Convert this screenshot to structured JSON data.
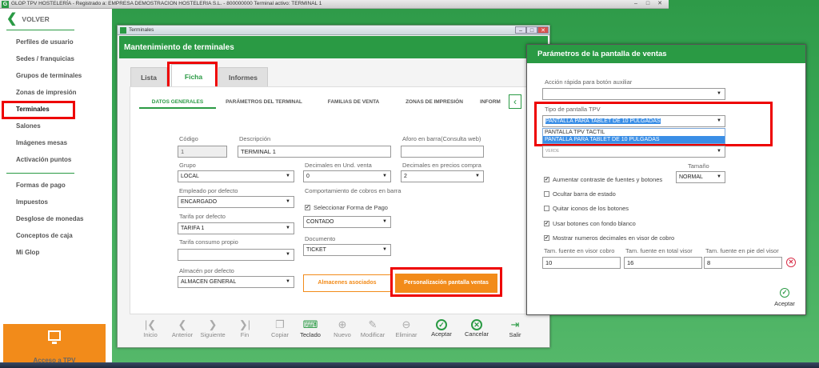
{
  "app_title": "GLOP TPV HOSTELERÍA - Registrado a: EMPRESA DEMOSTRACION HOSTELERIA S.L. - 800000000 Terminal activo: TERMINAL 1",
  "sidebar": {
    "back_label": "VOLVER",
    "items_top": [
      "Perfiles de usuario",
      "Sedes / franquicias",
      "Grupos de terminales",
      "Zonas de impresión",
      "Terminales",
      "Salones",
      "Imágenes mesas",
      "Activación puntos"
    ],
    "items_bottom": [
      "Formas de pago",
      "Impuestos",
      "Desglose de monedas",
      "Conceptos de caja",
      "Mi Glop"
    ],
    "active_item": "Terminales",
    "access_label": "Acceso a TPV"
  },
  "terminal_window": {
    "title": "Terminales",
    "header": "Mantenimiento de terminales",
    "tabs": [
      "Lista",
      "Ficha",
      "Informes"
    ],
    "selected_tab": "Ficha",
    "subtabs": [
      "DATOS GENERALES",
      "PARÁMETROS DEL TERMINAL",
      "FAMILIAS DE VENTA",
      "ZONAS DE IMPRESIÓN",
      "INFORM"
    ],
    "form": {
      "codigo_label": "Código",
      "codigo_value": "1",
      "descripcion_label": "Descripción",
      "descripcion_value": "TERMINAL 1",
      "aforo_label": "Aforo en barra(Consulta web)",
      "aforo_value": "",
      "grupo_label": "Grupo",
      "grupo_value": "LOCAL",
      "dec_und_label": "Decimales en Und. venta",
      "dec_und_value": "0",
      "dec_precios_label": "Decimales en precios compra",
      "dec_precios_value": "2",
      "empleado_label": "Empleado por defecto",
      "empleado_value": "ENCARGADO",
      "cobros_label": "Comportamiento de cobros en barra",
      "seleccionar_label": "Seleccionar Forma de Pago",
      "tarifa_label": "Tarifa por defecto",
      "tarifa_value": "TARIFA 1",
      "forma_value": "CONTADO",
      "tarifa_propio_label": "Tarifa consumo propio",
      "tarifa_propio_value": "",
      "documento_label": "Documento",
      "documento_value": "TICKET",
      "almacen_label": "Almacén por defecto",
      "almacen_value": "ALMACEN GENERAL",
      "almacenes_btn": "Almacenes asociados",
      "personalizacion_btn": "Personalización pantalla ventas"
    },
    "toolbar": [
      "Inicio",
      "Anterior",
      "Siguiente",
      "Fin",
      "Copiar",
      "Teclado",
      "Nuevo",
      "Modificar",
      "Eliminar",
      "Aceptar",
      "Cancelar",
      "Salir"
    ]
  },
  "dialog": {
    "title": "Parámetros de la pantalla de ventas",
    "accion_label": "Acción rápida para botón auxiliar",
    "accion_value": "",
    "tipo_label": "Tipo de pantalla TPV",
    "tipo_value": "PANTALLA PARA TABLET DE 10 PULGADAS",
    "tipo_options": [
      "PANTALLA TPV TACTIL",
      "PANTALLA PARA TABLET DE 10 PULGADAS"
    ],
    "hidden_value": "VERDE",
    "tamano_label": "Tamaño",
    "tamano_value": "NORMAL",
    "checks": [
      {
        "label": "Aumentar contraste de fuentes y botones",
        "checked": true
      },
      {
        "label": "Ocultar barra de estado",
        "checked": false
      },
      {
        "label": "Quitar iconos de los botones",
        "checked": false
      },
      {
        "label": "Usar botones con fondo blanco",
        "checked": true
      },
      {
        "label": "Mostrar numeros decimales en visor de cobro",
        "checked": true
      }
    ],
    "font_labels": [
      "Tam. fuente en visor cobro",
      "Tam. fuente en total visor",
      "Tam. fuente en pie del visor"
    ],
    "font_values": [
      "10",
      "16",
      "8"
    ],
    "accept_label": "Aceptar"
  }
}
